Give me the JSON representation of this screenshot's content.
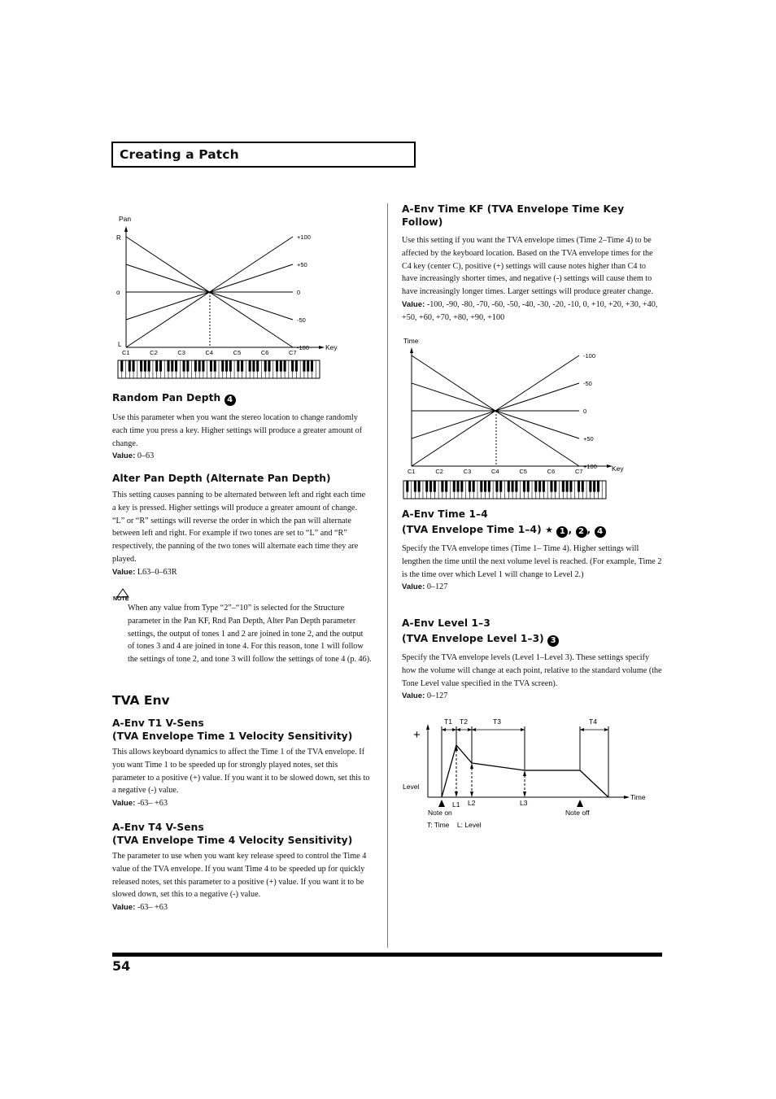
{
  "header": {
    "title": "Creating a Patch"
  },
  "page_number": "54",
  "pan_chart": {
    "y_axis_label": "Pan",
    "x_axis_label": "Key",
    "y_ticks": [
      "R",
      "o",
      "L"
    ],
    "x_ticks": [
      "C1",
      "C2",
      "C3",
      "C4",
      "C5",
      "C6",
      "C7"
    ],
    "line_labels": [
      "+100",
      "+50",
      "0",
      "-50",
      "-100"
    ],
    "line_values": [
      100,
      50,
      0,
      -50,
      -100
    ]
  },
  "random_pan": {
    "title": "Random Pan Depth",
    "badge": "4",
    "body": "Use this parameter when you want the stereo location to change randomly each time you press a key. Higher settings will produce a greater amount of change.",
    "value_label": "Value:",
    "value": " 0–63"
  },
  "alter_pan": {
    "title": "Alter Pan Depth (Alternate Pan Depth)",
    "body": "This setting causes panning to be alternated between left and right each time a key is pressed. Higher settings will produce a greater amount of change. “L” or “R” settings will reverse the order in which the pan will alternate between left and right. For example if two tones are set to “L” and “R” respectively, the panning of the two tones will alternate each time they are played.",
    "value_label": "Value:",
    "value": " L63–0–63R"
  },
  "note": {
    "icon_label": "NOTE",
    "body": "When any value from Type “2”–“10” is selected for the Structure parameter in the Pan KF, Rnd Pan Depth, Alter Pan Depth parameter settings, the output of tones 1 and 2 are joined in tone 2, and the output of tones 3 and 4 are joined in tone 4. For this reason, tone 1 will follow the settings of tone 2, and tone 3 will follow the settings of tone 4 (p. 46)."
  },
  "tva_env": {
    "title": "TVA Env",
    "t1": {
      "title_line1": "A-Env T1 V-Sens",
      "title_line2": "(TVA Envelope Time 1 Velocity Sensitivity)",
      "body": "This allows keyboard dynamics to affect the Time 1 of the TVA envelope. If you want Time 1 to be speeded up for strongly played notes, set this parameter to a positive (+) value. If you want it to be slowed down, set this to a negative (-) value.",
      "value_label": "Value:",
      "value": " -63– +63"
    },
    "t4": {
      "title_line1": "A-Env T4 V-Sens",
      "title_line2": "(TVA Envelope Time 4 Velocity Sensitivity)",
      "body": "The parameter to use when you want key release speed to control the Time 4 value of the TVA envelope. If you want Time 4 to be speeded up for quickly released notes, set this parameter to a positive (+) value. If you want it to be slowed down, set this to a negative (-) value.",
      "value_label": "Value:",
      "value": " -63– +63"
    }
  },
  "time_kf": {
    "title": "A-Env Time KF (TVA Envelope Time Key Follow)",
    "body": "Use this setting if you want the TVA envelope times (Time 2–Time 4) to be affected by the keyboard location. Based on the TVA envelope times for the C4 key (center C), positive (+) settings will cause notes higher than C4 to have increasingly shorter times, and negative (-) settings will cause them to have increasingly longer times. Larger settings will produce greater change.",
    "value_label": "Value:",
    "value": " -100, -90, -80, -70, -60, -50, -40, -30, -20, -10, 0, +10, +20, +30, +40, +50, +60, +70, +80, +90, +100"
  },
  "time_chart": {
    "y_axis_label": "Time",
    "x_axis_label": "Key",
    "x_ticks": [
      "C1",
      "C2",
      "C3",
      "C4",
      "C5",
      "C6",
      "C7"
    ],
    "line_labels": [
      "-100",
      "-50",
      "0",
      "+50",
      "+100"
    ],
    "line_values": [
      -100,
      -50,
      0,
      50,
      100
    ]
  },
  "env_time": {
    "title_line1": "A-Env Time 1–4",
    "title_line2": "(TVA Envelope Time 1–4)",
    "star": "★",
    "badges": [
      "1",
      "2",
      "4"
    ],
    "body": "Specify the TVA envelope times (Time 1– Time 4). Higher settings will lengthen the time until the next volume level is reached. (For example, Time 2 is the time over which Level 1 will change to Level 2.)",
    "value_label": "Value:",
    "value": " 0–127"
  },
  "env_level": {
    "title_line1": "A-Env Level 1–3",
    "title_line2": "(TVA Envelope Level 1–3)",
    "badge": "3",
    "body": "Specify the TVA envelope levels (Level 1–Level 3). These settings specify how the volume will change at each point, relative to the standard volume (the Tone Level value specified in the TVA screen).",
    "value_label": "Value:",
    "value": " 0–127"
  },
  "envelope_diagram": {
    "plus": "+",
    "y_label": "Level",
    "x_label": "Time",
    "time_labels": [
      "T1",
      "T2",
      "T3",
      "T4"
    ],
    "level_labels": [
      "L1",
      "L2",
      "L3"
    ],
    "note_on": "Note on",
    "note_off": "Note off",
    "legend": "T: Time    L: Level"
  }
}
